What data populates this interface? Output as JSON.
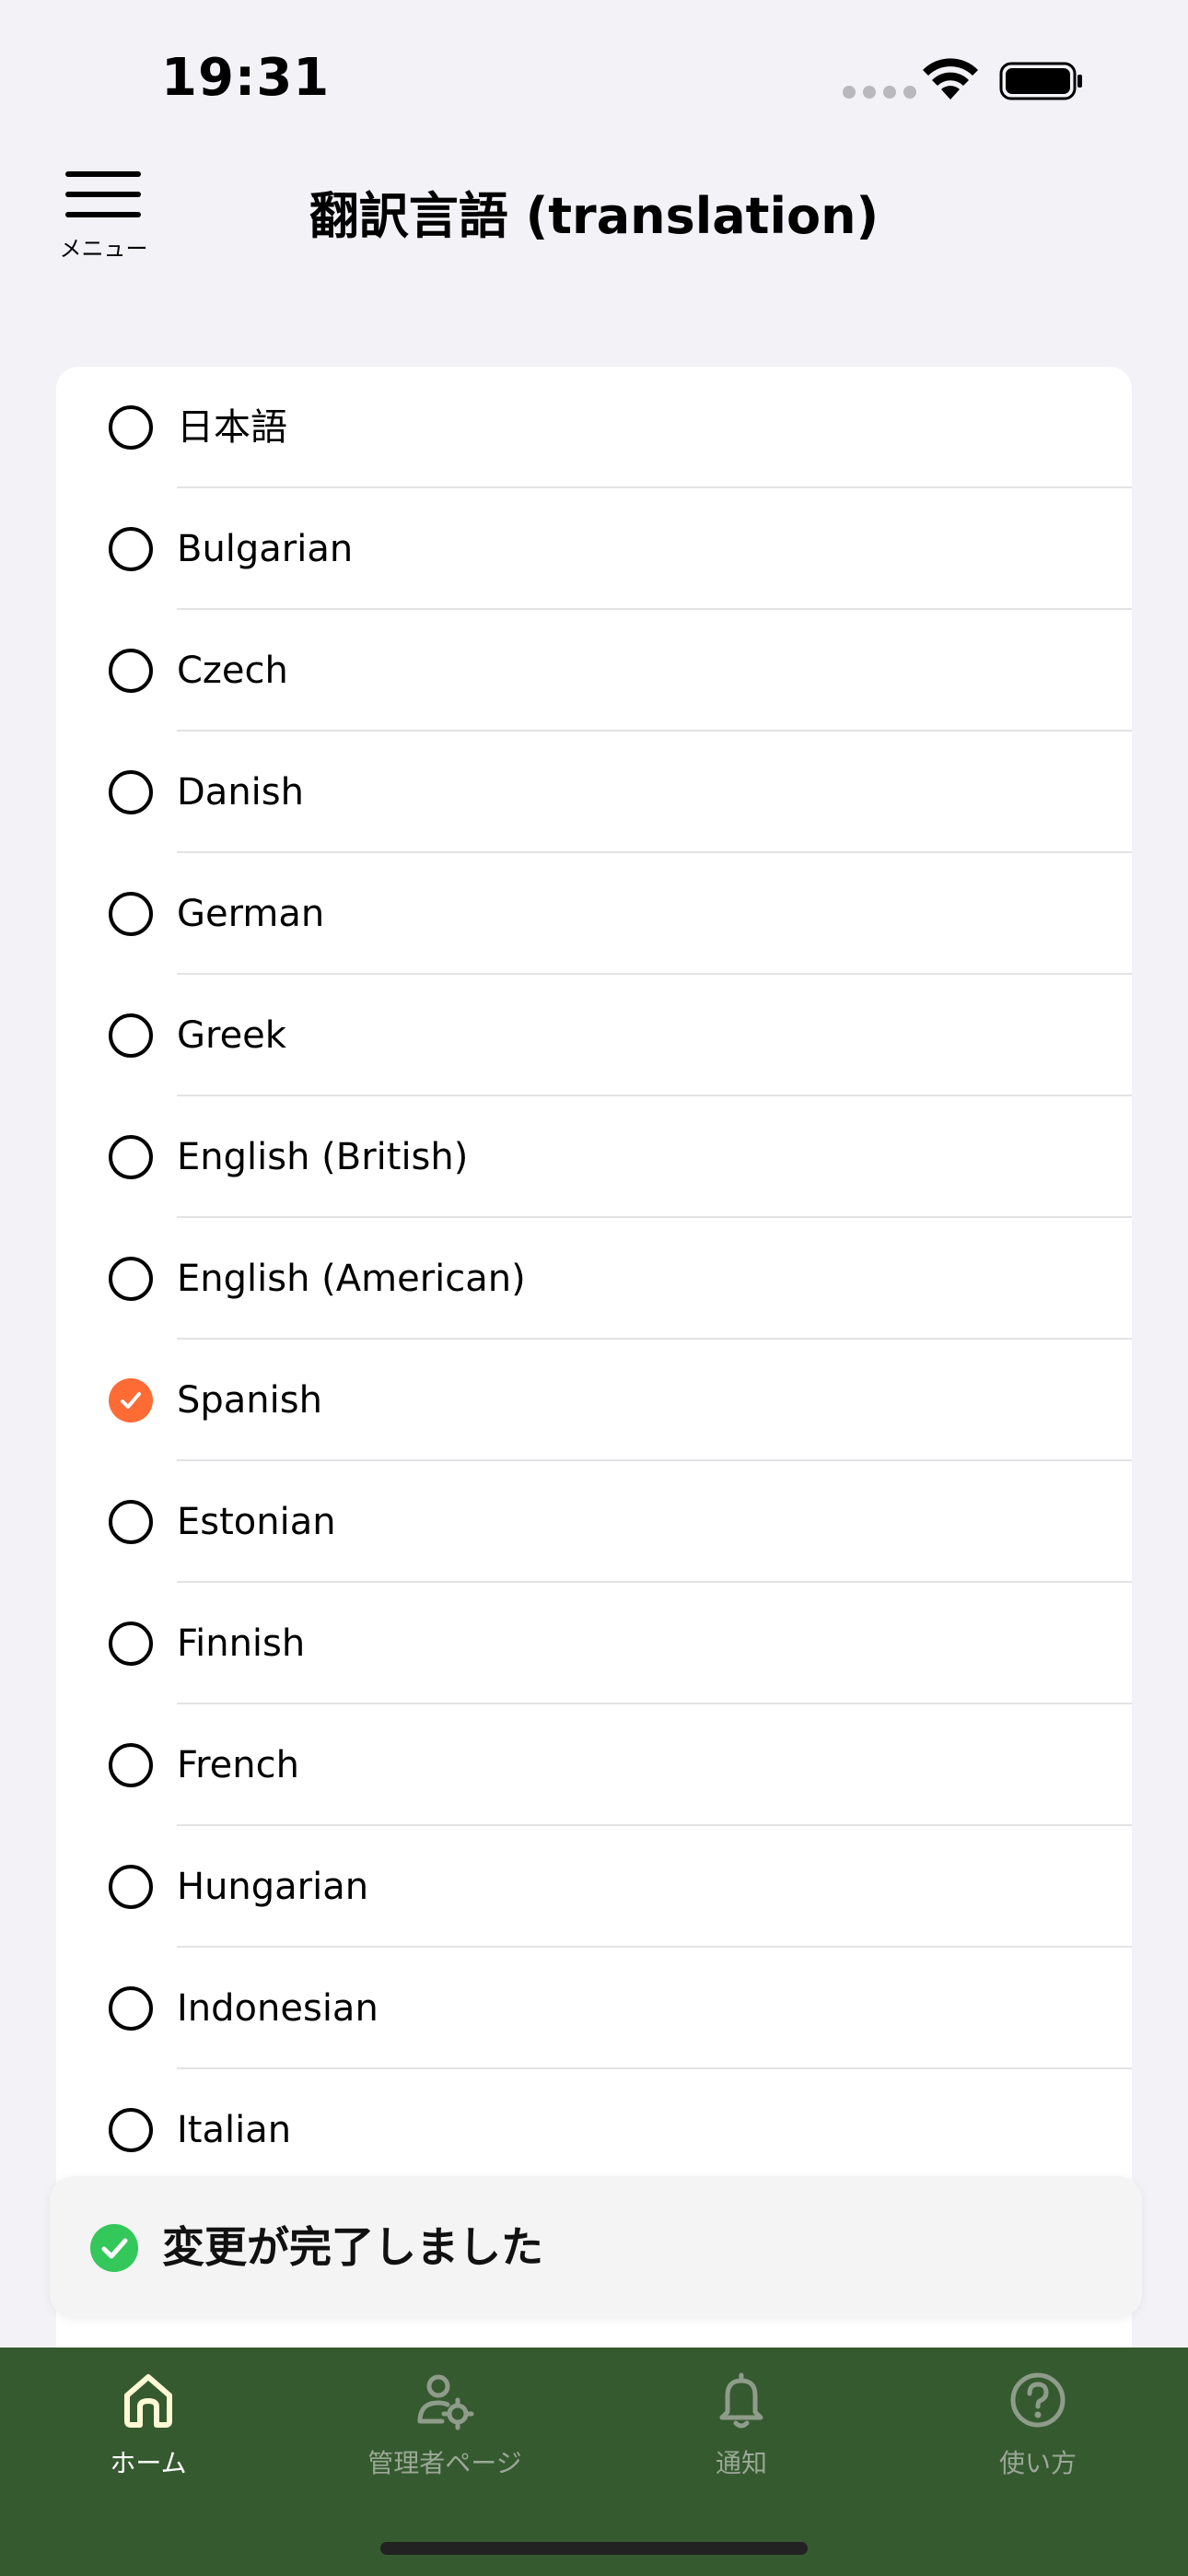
{
  "status_bar": {
    "time": "19:31"
  },
  "header": {
    "menu_label": "メニュー",
    "title": "翻訳言語 (translation)"
  },
  "languages": [
    {
      "label": "日本語",
      "selected": false
    },
    {
      "label": "Bulgarian",
      "selected": false
    },
    {
      "label": "Czech",
      "selected": false
    },
    {
      "label": "Danish",
      "selected": false
    },
    {
      "label": "German",
      "selected": false
    },
    {
      "label": "Greek",
      "selected": false
    },
    {
      "label": "English (British)",
      "selected": false
    },
    {
      "label": "English (American)",
      "selected": false
    },
    {
      "label": "Spanish",
      "selected": true
    },
    {
      "label": "Estonian",
      "selected": false
    },
    {
      "label": "Finnish",
      "selected": false
    },
    {
      "label": "French",
      "selected": false
    },
    {
      "label": "Hungarian",
      "selected": false
    },
    {
      "label": "Indonesian",
      "selected": false
    },
    {
      "label": "Italian",
      "selected": false
    }
  ],
  "toast": {
    "message": "変更が完了しました",
    "icon": "check-circle-icon"
  },
  "tab_bar": {
    "tabs": [
      {
        "label": "ホーム",
        "icon": "home-icon",
        "active": true
      },
      {
        "label": "管理者ページ",
        "icon": "admin-gear-user-icon",
        "active": false
      },
      {
        "label": "通知",
        "icon": "bell-icon",
        "active": false
      },
      {
        "label": "使い方",
        "icon": "help-circle-icon",
        "active": false
      }
    ]
  },
  "colors": {
    "accent": "#ff6b35",
    "tab_bar_bg": "#365a30",
    "toast_check": "#34c759",
    "background": "#f2f2f7"
  }
}
